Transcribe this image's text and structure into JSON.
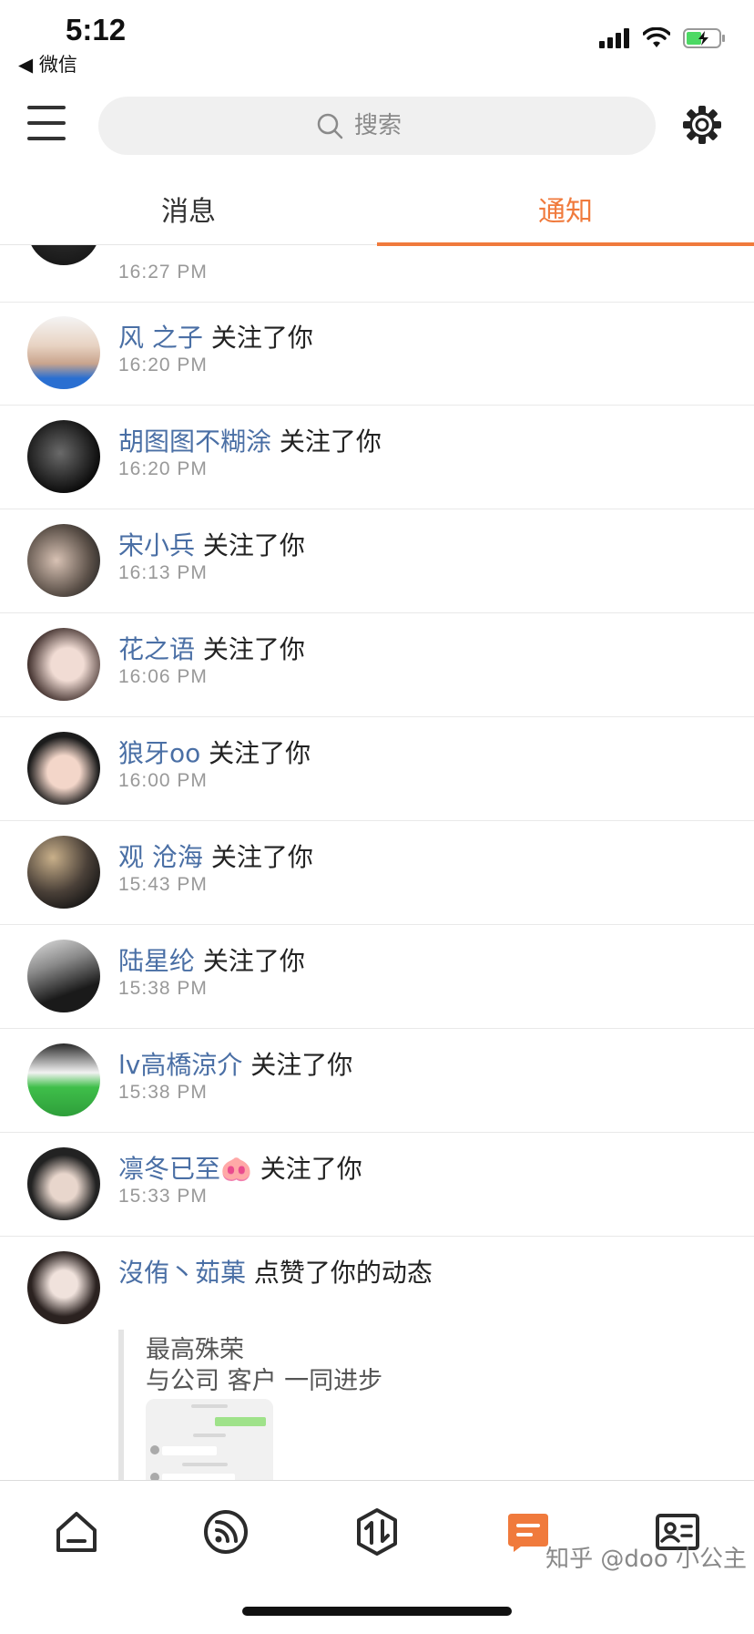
{
  "status_bar": {
    "time": "5:12",
    "back_app": "◀ 微信"
  },
  "header": {
    "search_placeholder": "搜索"
  },
  "tabs": [
    {
      "label": "消息"
    },
    {
      "label": "通知"
    }
  ],
  "notifications": [
    {
      "time": "16:27 PM"
    },
    {
      "name": "风 之子",
      "action": "关注了你",
      "time": "16:20 PM"
    },
    {
      "name": "胡图图不糊涂",
      "action": "关注了你",
      "time": "16:20 PM"
    },
    {
      "name": "宋小兵",
      "action": "关注了你",
      "time": "16:13 PM"
    },
    {
      "name": "花之语",
      "action": "关注了你",
      "time": "16:06 PM"
    },
    {
      "name": "狼牙oo",
      "action": "关注了你",
      "time": "16:00 PM"
    },
    {
      "name": "观 沧海",
      "action": "关注了你",
      "time": "15:43 PM"
    },
    {
      "name": "陆星纶",
      "action": "关注了你",
      "time": "15:38 PM"
    },
    {
      "name": "lv高橋涼介",
      "action": "关注了你",
      "time": "15:38 PM"
    },
    {
      "name": "凛冬已至🐽",
      "action": "关注了你",
      "time": "15:33 PM"
    },
    {
      "name": "沒侑丶茹菓",
      "action": "点赞了你的动态",
      "post_line1": "最高殊荣",
      "post_line2": "与公司 客户 一同进步"
    }
  ],
  "watermark": "知乎 @doo 小公主",
  "colors": {
    "accent": "#f07a3c",
    "name_link": "#4a6fa5",
    "time_gray": "#999999"
  },
  "icons": [
    "home-icon",
    "feed-icon",
    "exchange-icon",
    "message-icon",
    "contact-card-icon"
  ]
}
